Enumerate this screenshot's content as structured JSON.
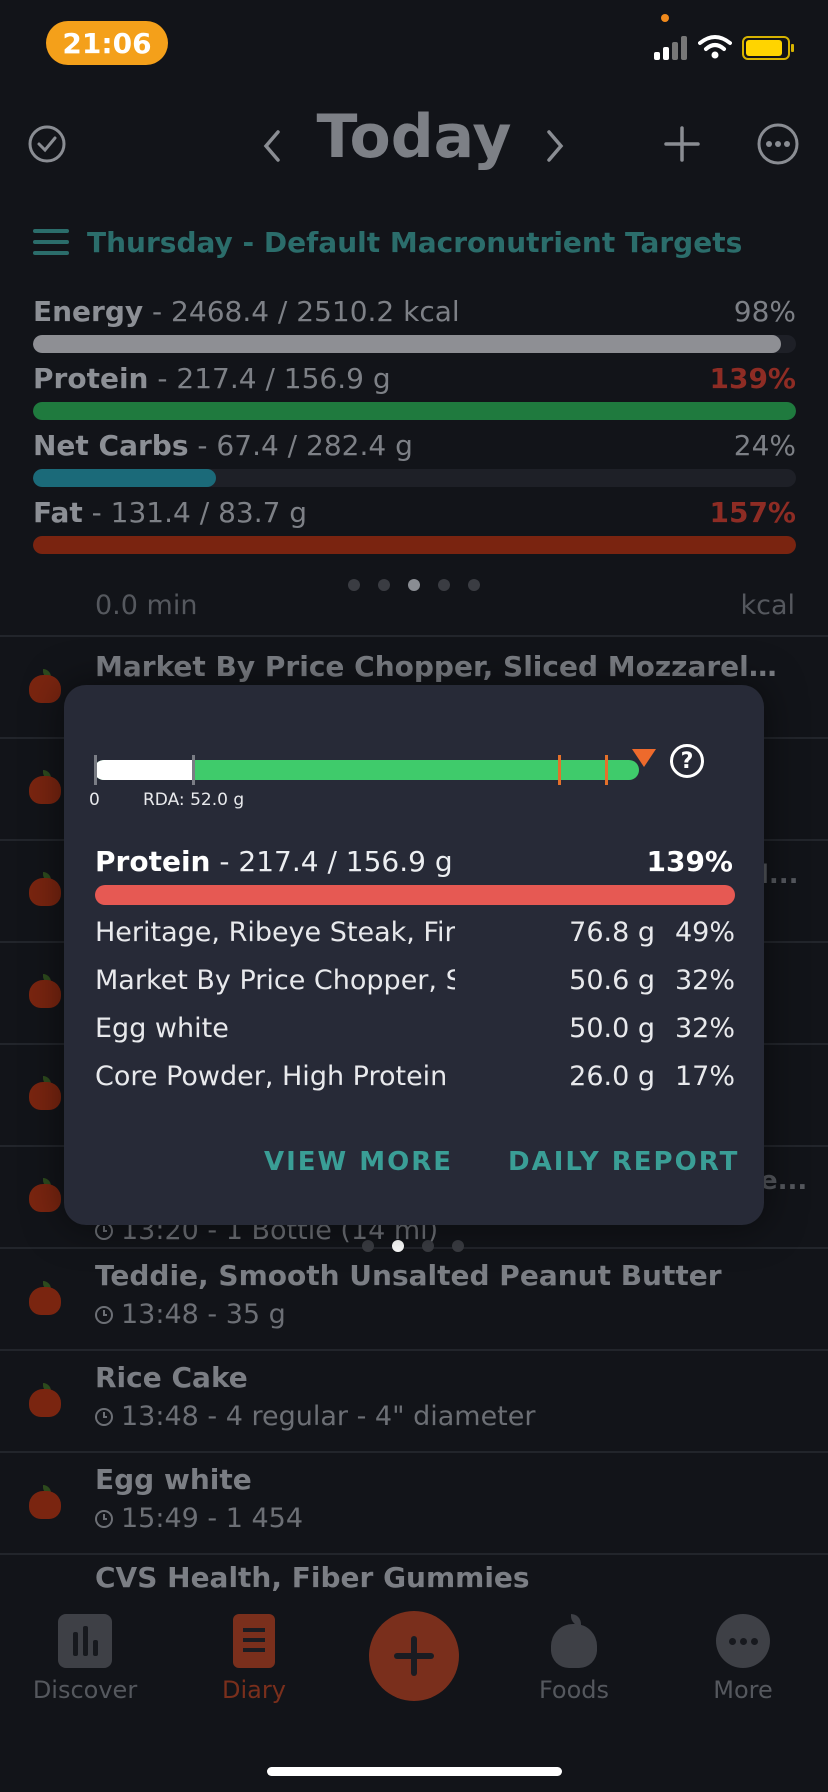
{
  "status_bar": {
    "time": "21:06"
  },
  "header": {
    "title": "Today",
    "subtitle": "Thursday - Default Macronutrient Targets"
  },
  "macros": [
    {
      "name": "Energy",
      "detail": " - 2468.4 / 2510.2 kcal",
      "percent": "98%",
      "fill_fraction": 0.98,
      "color": "#8e8f94",
      "over": false
    },
    {
      "name": "Protein",
      "detail": " - 217.4 / 156.9 g",
      "percent": "139%",
      "fill_fraction": 1.0,
      "color": "#1f7a3e",
      "over": true
    },
    {
      "name": "Net Carbs",
      "detail": " - 67.4 / 282.4 g",
      "percent": "24%",
      "fill_fraction": 0.24,
      "color": "#1b6a79",
      "over": false
    },
    {
      "name": "Fat",
      "detail": " - 131.4 / 83.7 g",
      "percent": "157%",
      "fill_fraction": 1.0,
      "color": "#7a2410",
      "over": true
    }
  ],
  "diary": {
    "partial_top_left": "0.0 min",
    "partial_top_right": "kcal",
    "items": [
      {
        "name": "Market By Price Chopper, Sliced Mozzarella Ch..."
      },
      {
        "name": ""
      },
      {
        "name": "",
        "suffix": "l..."
      },
      {
        "name": ""
      },
      {
        "name": ""
      },
      {
        "name": "",
        "suffix": "e...",
        "meta": "13:20 - 1 Bottle (14 ml)"
      },
      {
        "name": "Teddie, Smooth Unsalted Peanut Butter",
        "meta": "13:48 - 35 g"
      },
      {
        "name": "Rice Cake",
        "meta": "13:48 - 4 regular - 4\" diameter"
      },
      {
        "name": "Egg white",
        "meta": "15:49 - 1 454"
      },
      {
        "name": "CVS Health, Fiber Gummies"
      }
    ]
  },
  "popup": {
    "gauge_zero": "0",
    "gauge_rda": "RDA: 52.0 g",
    "gauge_value_fraction": 1.39,
    "nutrient_name": "Protein",
    "nutrient_detail": " - 217.4 / 156.9 g",
    "nutrient_percent": "139%",
    "contributors": [
      {
        "name": "Heritage, Ribeye Steak, Fin...",
        "amount": "76.8 g",
        "percent": "49%"
      },
      {
        "name": "Market By Price Chopper, S...",
        "amount": "50.6 g",
        "percent": "32%"
      },
      {
        "name": "Egg white",
        "amount": "50.0 g",
        "percent": "32%"
      },
      {
        "name": "Core Powder, High Protein ...",
        "amount": "26.0 g",
        "percent": "17%"
      }
    ],
    "view_more": "VIEW MORE",
    "daily_report": "DAILY REPORT"
  },
  "tabbar": {
    "discover": "Discover",
    "diary": "Diary",
    "foods": "Foods",
    "more": "More"
  },
  "colors": {
    "accent": "#3a9e96",
    "over": "#e65953",
    "gauge_green": "#3fcb6b"
  }
}
